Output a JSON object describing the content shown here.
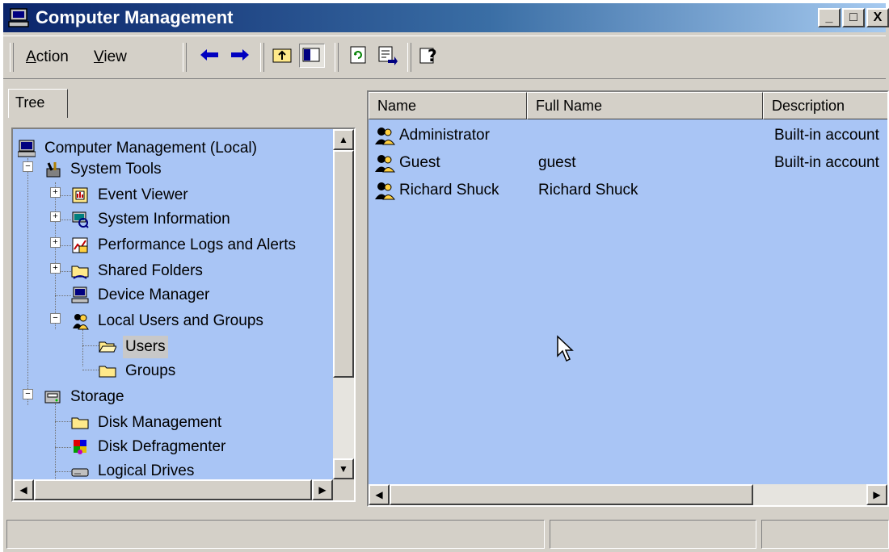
{
  "window": {
    "title": "Computer Management",
    "controls": {
      "minimize": "_",
      "maximize": "□",
      "close": "X"
    }
  },
  "menubar": {
    "action": "Action",
    "view": "View"
  },
  "toolbar": {
    "buttons": [
      "back-icon",
      "forward-icon",
      "up-one-level-icon",
      "show-hide-tree-icon",
      "refresh-icon",
      "export-list-icon",
      "help-icon"
    ]
  },
  "tree_tab": "Tree",
  "tree": {
    "root": "Computer Management (Local)",
    "system_tools": "System Tools",
    "event_viewer": "Event Viewer",
    "system_information": "System Information",
    "performance_logs": "Performance Logs and Alerts",
    "shared_folders": "Shared Folders",
    "device_manager": "Device Manager",
    "local_users_groups": "Local Users and Groups",
    "users": "Users",
    "groups": "Groups",
    "storage": "Storage",
    "disk_management": "Disk Management",
    "disk_defragmenter": "Disk Defragmenter",
    "logical_drives": "Logical Drives",
    "selected": "Users"
  },
  "list": {
    "columns": [
      "Name",
      "Full Name",
      "Description"
    ],
    "rows": [
      {
        "name": "Administrator",
        "full_name": "",
        "description": "Built-in account"
      },
      {
        "name": "Guest",
        "full_name": "guest",
        "description": "Built-in account"
      },
      {
        "name": "Richard Shuck",
        "full_name": "Richard Shuck",
        "description": ""
      }
    ]
  },
  "colors": {
    "pane_bg": "#a9c5f5",
    "chrome": "#d4d0c8",
    "title_start": "#0a246a",
    "title_end": "#a6caf0"
  }
}
